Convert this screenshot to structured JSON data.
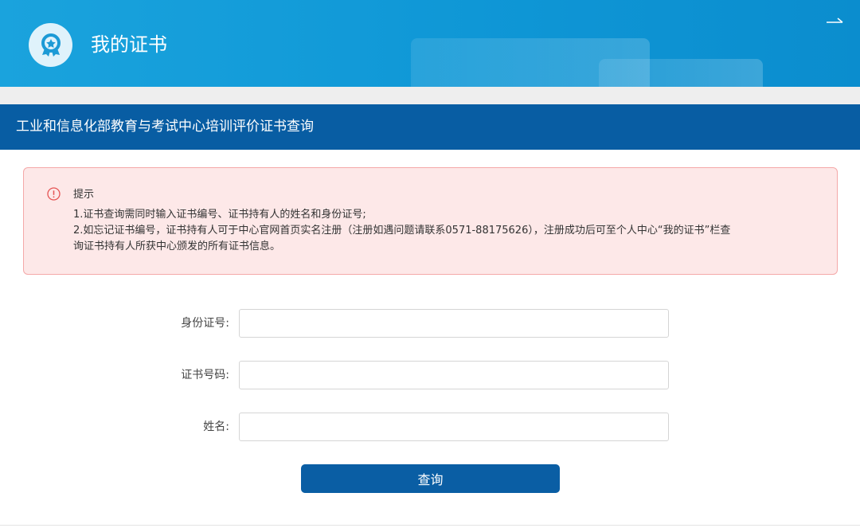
{
  "header": {
    "title": "我的证书",
    "logo_icon": "award-badge-icon",
    "corner_icon": "return-arrow-icon"
  },
  "section": {
    "title": "工业和信息化部教育与考试中心培训评价证书查询"
  },
  "alert": {
    "icon": "exclamation-circle-icon",
    "title": "提示",
    "lines": [
      "1.证书查询需同时输入证书编号、证书持有人的姓名和身份证号;",
      "2.如忘记证书编号，证书持有人可于中心官网首页实名注册（注册如遇问题请联系0571-88175626），注册成功后可至个人中心“我的证书”栏查",
      "询证书持有人所获中心颁发的所有证书信息。"
    ]
  },
  "form": {
    "id_label": "身份证号:",
    "id_value": "",
    "cert_label": "证书号码:",
    "cert_value": "",
    "name_label": "姓名:",
    "name_value": "",
    "submit_label": "查询"
  },
  "colors": {
    "header": "#129ad8",
    "section_bar": "#085da3",
    "alert_bg": "#fde8e8",
    "alert_border": "#f4a8a8",
    "button": "#0a5ea4"
  }
}
